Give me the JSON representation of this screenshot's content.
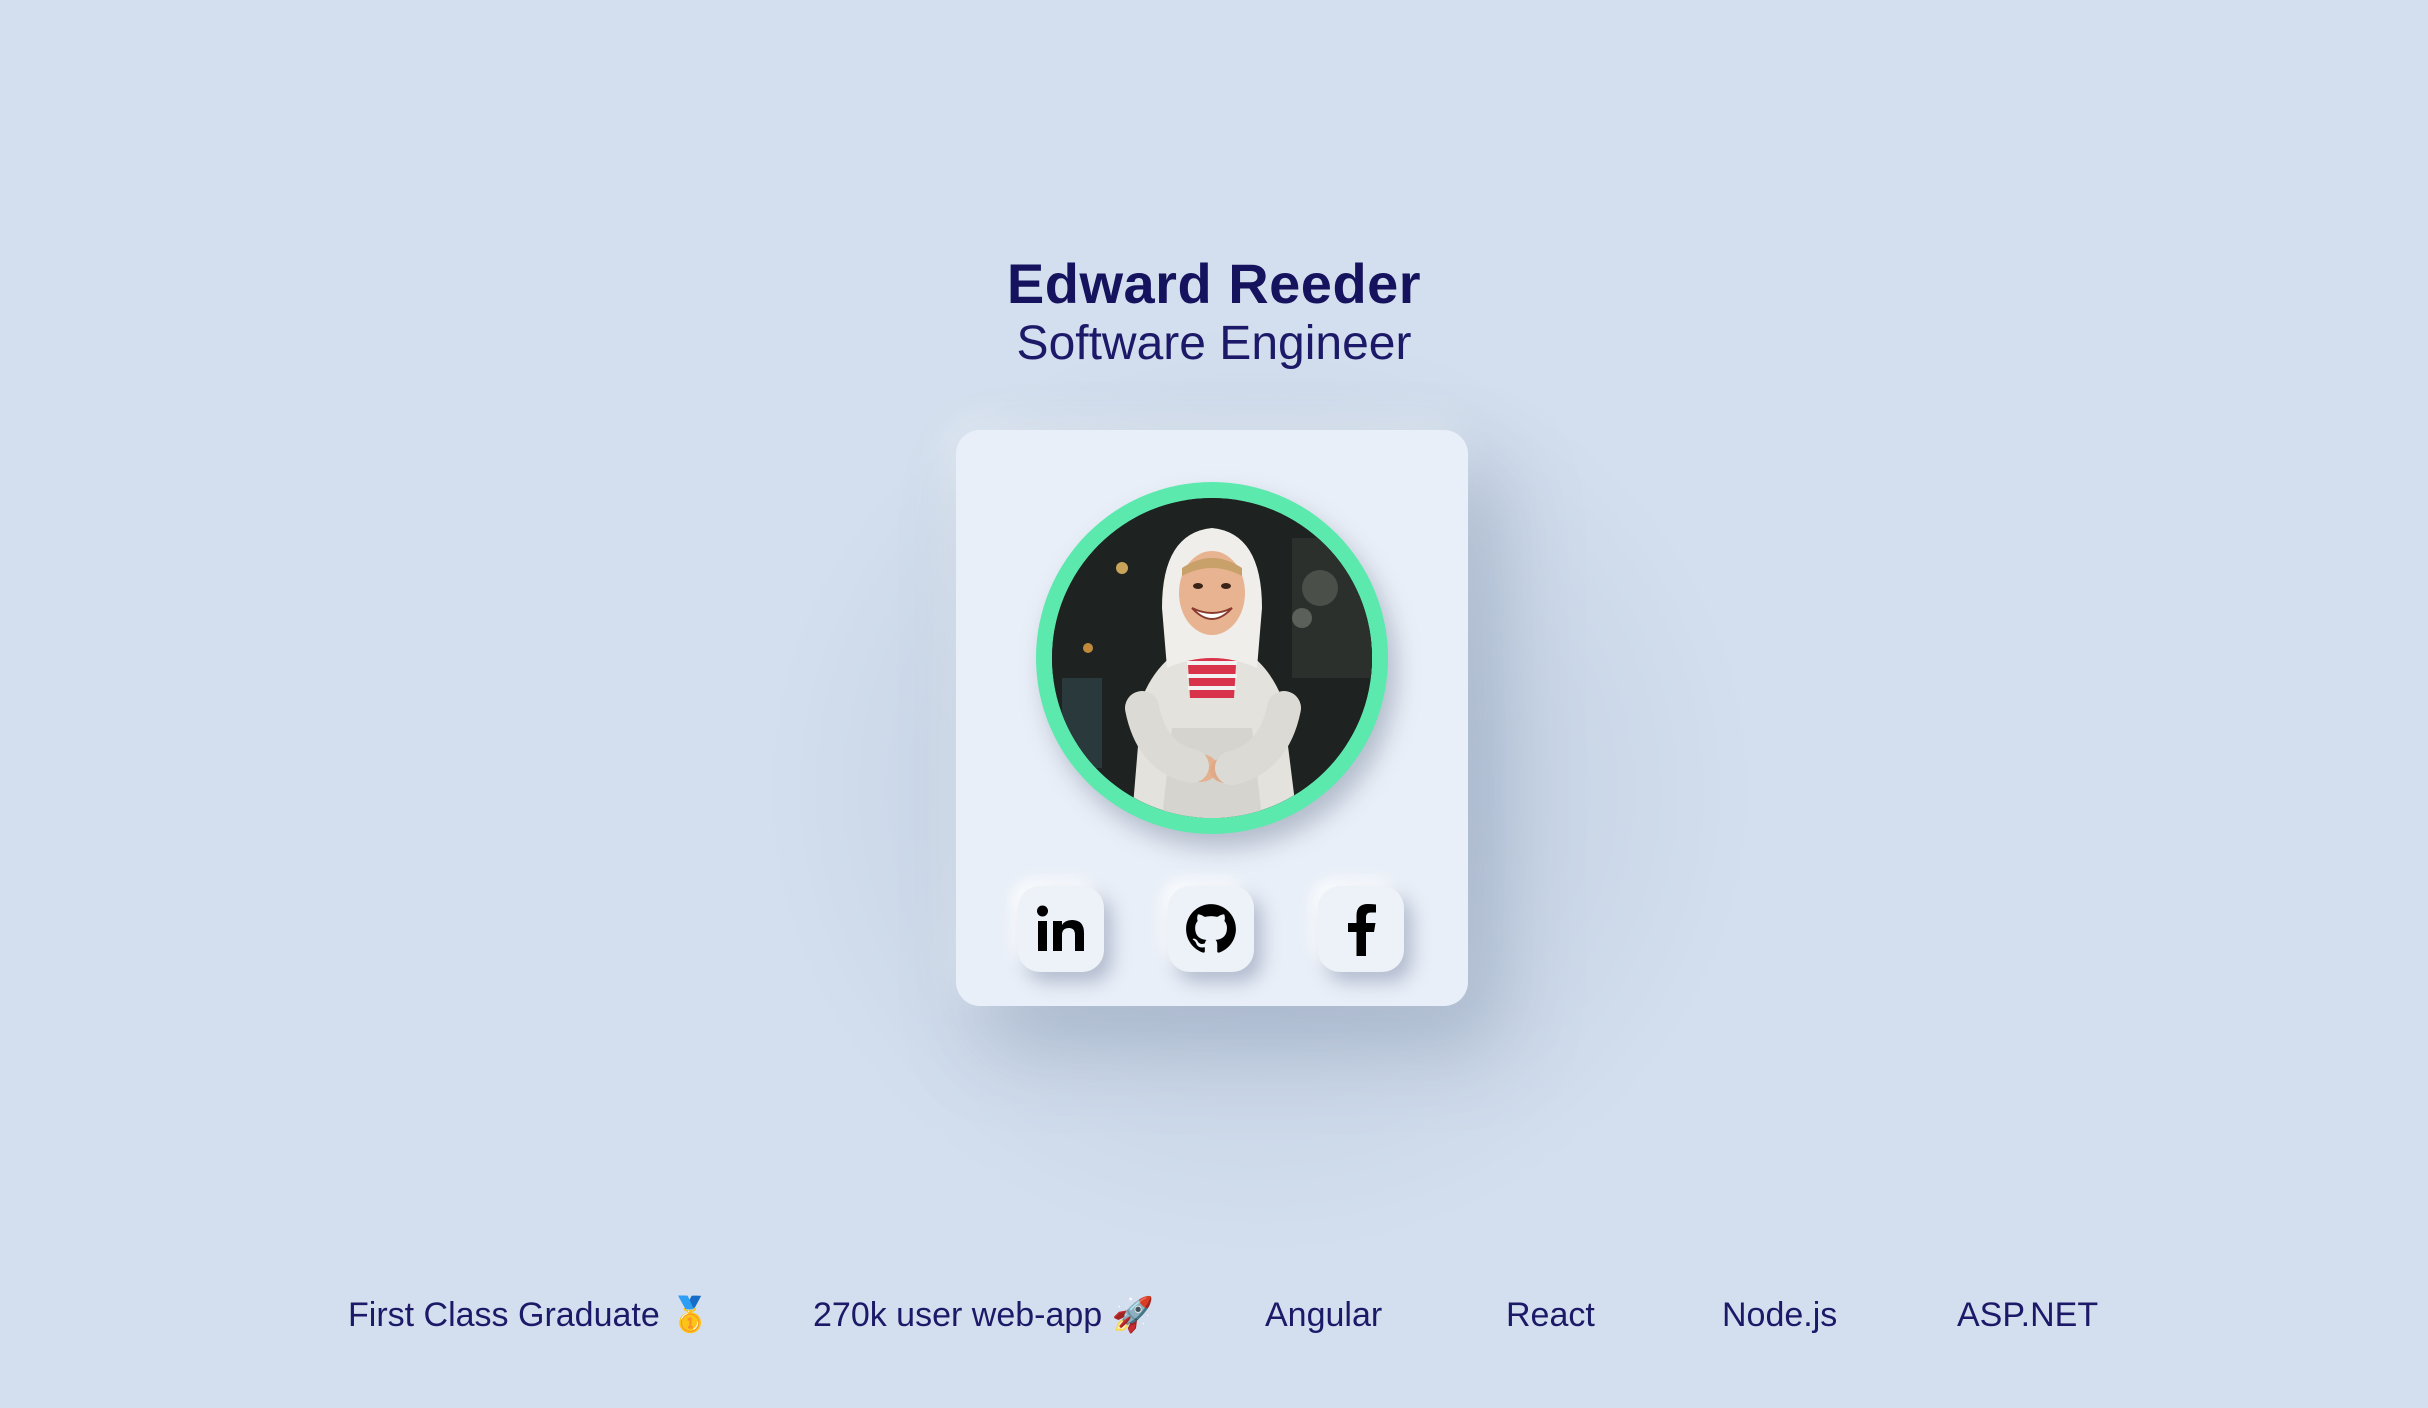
{
  "profile": {
    "name": "Edward Reeder",
    "role": "Software Engineer"
  },
  "avatar": {
    "ring_color": "#5ce9ad"
  },
  "socials": [
    {
      "name": "LinkedIn",
      "icon": "linkedin-icon"
    },
    {
      "name": "GitHub",
      "icon": "github-icon"
    },
    {
      "name": "Facebook",
      "icon": "facebook-icon"
    }
  ],
  "highlights": [
    "First Class Graduate 🥇",
    "270k user web-app 🚀",
    "Angular",
    "React",
    "Node.js",
    "ASP.NET"
  ],
  "colors": {
    "background": "#d3dfee",
    "card": "#e9eff8",
    "text": "#17145e",
    "accent": "#5ce9ad"
  }
}
